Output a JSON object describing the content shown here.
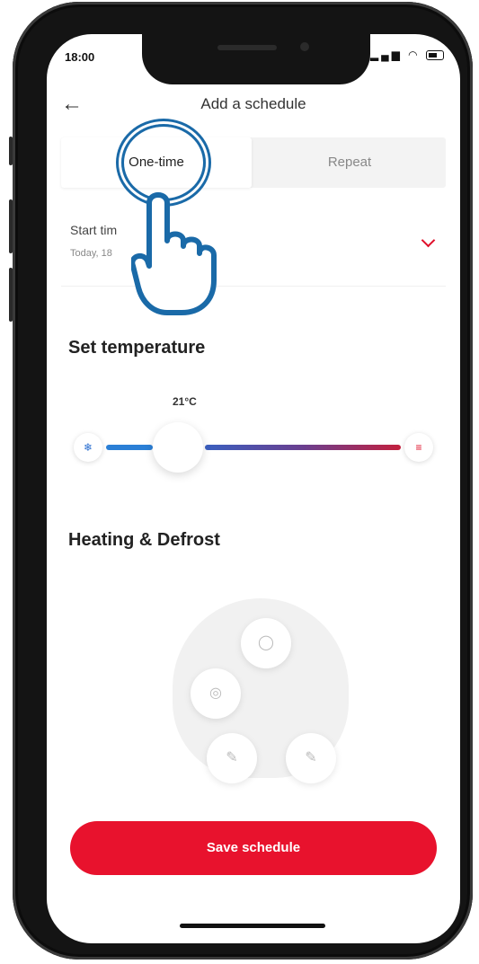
{
  "status_bar": {
    "time": "18:00"
  },
  "header": {
    "title": "Add a schedule"
  },
  "segment": {
    "one_time": "One-time",
    "repeat": "Repeat",
    "selected": "One-time"
  },
  "start_time": {
    "label": "Start tim",
    "value": "Today, 18"
  },
  "temperature": {
    "section_title": "Set temperature",
    "value": "21°C",
    "level_fraction": 0.3
  },
  "heating": {
    "section_title": "Heating & Defrost"
  },
  "save_button": {
    "label": "Save schedule"
  },
  "colors": {
    "accent_red": "#e8122d",
    "cold_blue": "#2a7fd6"
  },
  "icons": [
    "back-arrow-icon",
    "chevron-down-icon",
    "snowflake-icon",
    "heat-lines-icon",
    "tap-hand-icon"
  ]
}
